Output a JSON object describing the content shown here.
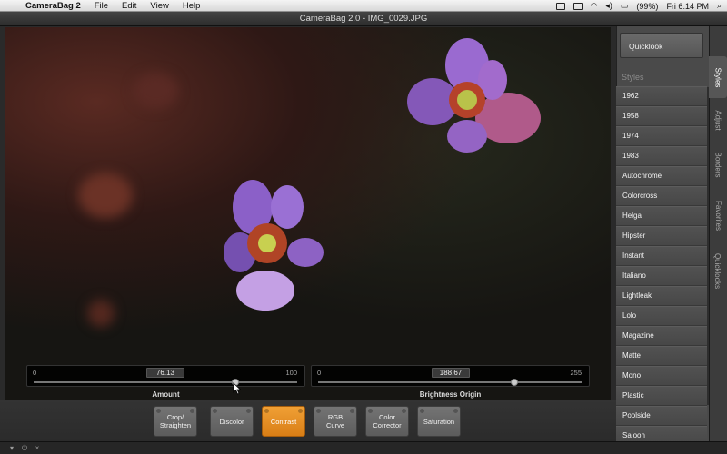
{
  "menubar": {
    "apple": "",
    "app_name": "CameraBag 2",
    "items": [
      "File",
      "Edit",
      "View",
      "Help"
    ],
    "battery": "(99%)",
    "clock": "Fri 6:14 PM"
  },
  "window": {
    "title": "CameraBag 2.0 - IMG_0029.JPG"
  },
  "sliders": [
    {
      "min": "0",
      "max": "100",
      "value": "76.13",
      "fraction": 0.7613,
      "label": "Amount"
    },
    {
      "min": "0",
      "max": "255",
      "value": "188.67",
      "fraction": 0.74,
      "label": "Brightness Origin"
    }
  ],
  "tools": [
    {
      "label": "Crop/\nStraighten",
      "active": false
    },
    {
      "label": "Discolor",
      "active": false
    },
    {
      "label": "Contrast",
      "active": true
    },
    {
      "label": "RGB\nCurve",
      "active": false
    },
    {
      "label": "Color\nCorrector",
      "active": false
    },
    {
      "label": "Saturation",
      "active": false
    }
  ],
  "sidebar": {
    "quicklook": "Quicklook",
    "styles_heading": "Styles",
    "styles": [
      "1962",
      "1958",
      "1974",
      "1983",
      "Autochrome",
      "Colorcross",
      "Helga",
      "Hipster",
      "Instant",
      "Italiano",
      "Lightleak",
      "Lolo",
      "Magazine",
      "Matte",
      "Mono",
      "Plastic",
      "Poolside",
      "Saloon"
    ]
  },
  "tabs": [
    "Styles",
    "Adjust",
    "Borders",
    "Favorites",
    "Quicklooks"
  ],
  "colors": {
    "accent": "#e8912a",
    "sidebar": "#4a4a4a",
    "flower": "#8a5cc4"
  }
}
